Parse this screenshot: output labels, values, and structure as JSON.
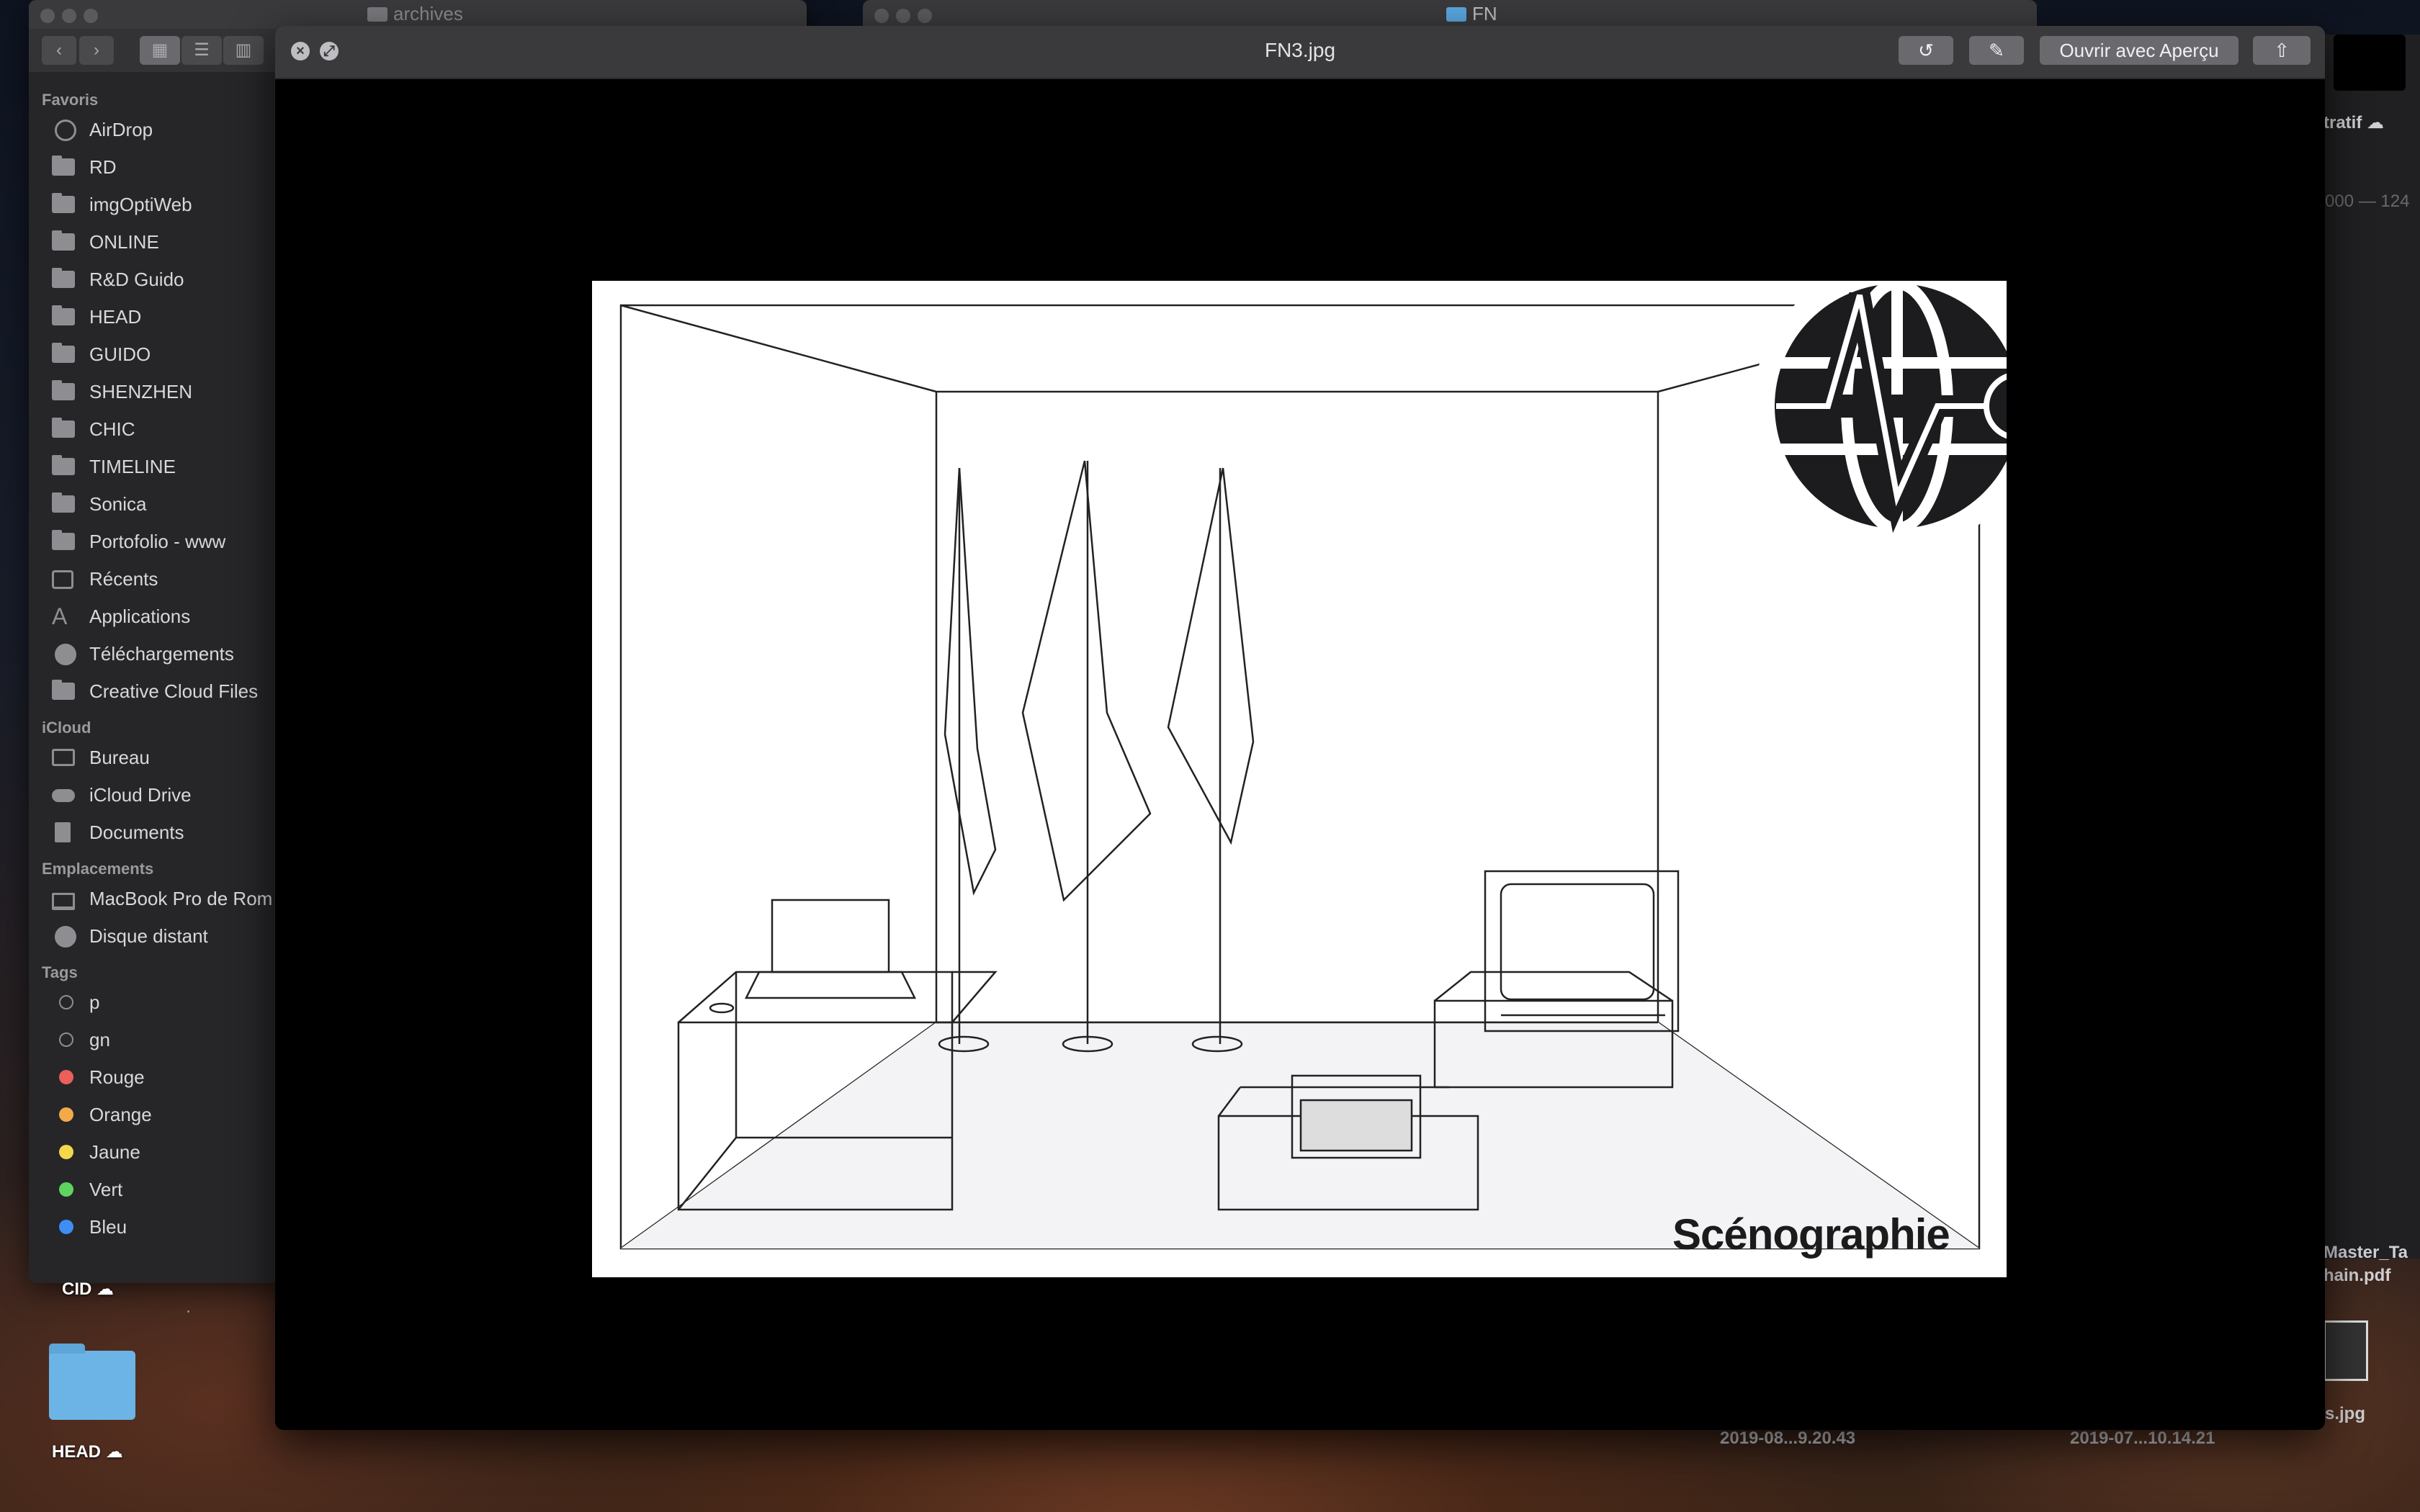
{
  "desktop": {
    "items": [
      {
        "label": "HEAD"
      },
      {
        "label": "CID"
      }
    ],
    "date_labels": [
      "2019-08...9.20.43",
      "2019-07...10.14.21"
    ],
    "right_texts": [
      "tratif",
      "000 — 124",
      "Master_Ta",
      "hain.pdf",
      "s.jpg"
    ]
  },
  "finder": {
    "title": "archives",
    "sidebar": {
      "favoris_header": "Favoris",
      "favoris": [
        {
          "label": "AirDrop",
          "icon": "airdrop-icon"
        },
        {
          "label": "RD",
          "icon": "folder-icon"
        },
        {
          "label": "imgOptiWeb",
          "icon": "folder-icon"
        },
        {
          "label": "ONLINE",
          "icon": "folder-icon"
        },
        {
          "label": "R&D Guido",
          "icon": "folder-icon"
        },
        {
          "label": "HEAD",
          "icon": "folder-icon"
        },
        {
          "label": "GUIDO",
          "icon": "folder-icon"
        },
        {
          "label": "SHENZHEN",
          "icon": "folder-icon"
        },
        {
          "label": "CHIC",
          "icon": "folder-icon"
        },
        {
          "label": "TIMELINE",
          "icon": "folder-icon"
        },
        {
          "label": "Sonica",
          "icon": "folder-icon"
        },
        {
          "label": "Portofolio - www",
          "icon": "folder-icon"
        },
        {
          "label": "Récents",
          "icon": "recents-icon"
        },
        {
          "label": "Applications",
          "icon": "applications-icon"
        },
        {
          "label": "Téléchargements",
          "icon": "downloads-icon"
        },
        {
          "label": "Creative Cloud Files",
          "icon": "folder-icon"
        }
      ],
      "icloud_header": "iCloud",
      "icloud": [
        {
          "label": "Bureau",
          "icon": "desktop-icon"
        },
        {
          "label": "iCloud Drive",
          "icon": "cloud-icon"
        },
        {
          "label": "Documents",
          "icon": "document-icon"
        }
      ],
      "emplacements_header": "Emplacements",
      "emplacements": [
        {
          "label": "MacBook Pro de Rom",
          "icon": "laptop-icon"
        },
        {
          "label": "Disque distant",
          "icon": "disc-icon"
        }
      ],
      "tags_header": "Tags",
      "tags": [
        {
          "label": "p",
          "color": "#2b2b2d"
        },
        {
          "label": "gn",
          "color": "#2b2b2d"
        },
        {
          "label": "Rouge",
          "color": "#ec5f5a"
        },
        {
          "label": "Orange",
          "color": "#f4a94a"
        },
        {
          "label": "Jaune",
          "color": "#f4d74b"
        },
        {
          "label": "Vert",
          "color": "#5fd35f"
        },
        {
          "label": "Bleu",
          "color": "#3d8ef5"
        }
      ]
    }
  },
  "second_window": {
    "title": "FN"
  },
  "quicklook": {
    "title": "FN3.jpg",
    "open_with_label": "Ouvrir avec Aperçu",
    "image_caption": "Scénographie"
  }
}
